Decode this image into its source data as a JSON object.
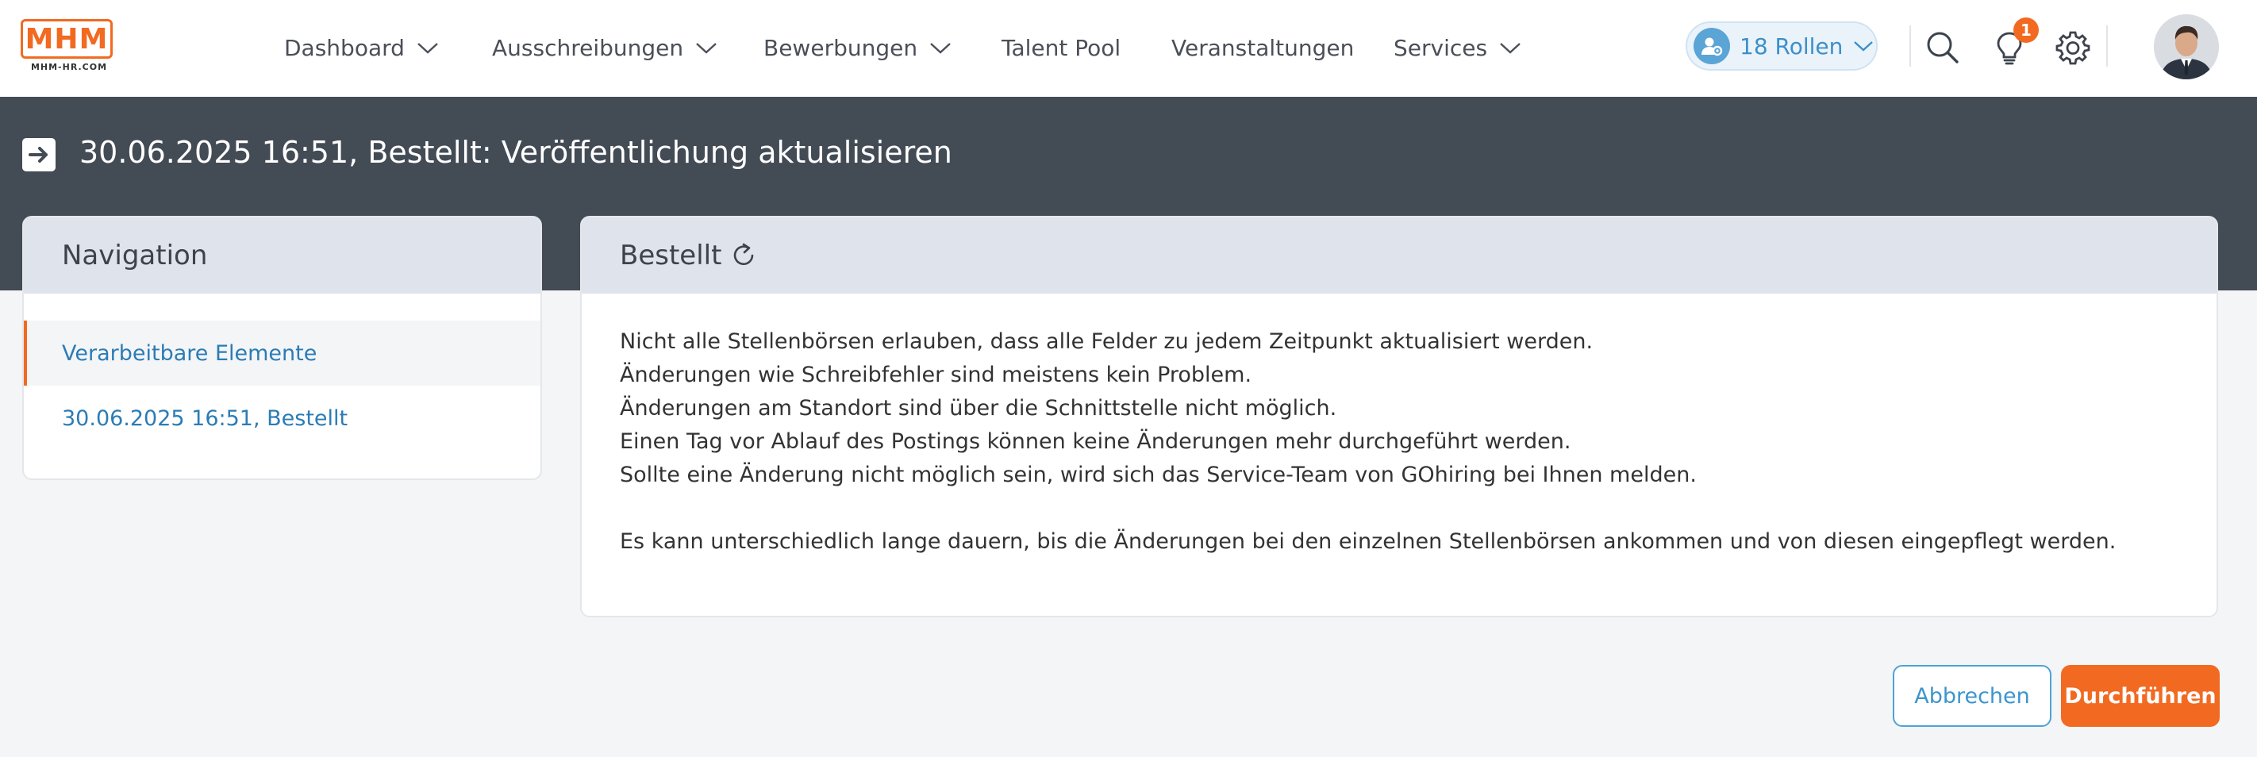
{
  "header": {
    "logo": {
      "text": "MHM",
      "subtext": "MHM-HR.COM"
    },
    "nav": [
      {
        "label": "Dashboard",
        "dropdown": true
      },
      {
        "label": "Ausschreibungen",
        "dropdown": true
      },
      {
        "label": "Bewerbungen",
        "dropdown": true
      },
      {
        "label": "Talent Pool",
        "dropdown": false
      },
      {
        "label": "Veranstaltungen",
        "dropdown": false
      },
      {
        "label": "Services",
        "dropdown": true
      }
    ],
    "roles_label": "18 Rollen",
    "notification_count": "1",
    "icons": [
      "user-gear-icon",
      "search-icon",
      "lightbulb-icon",
      "gear-icon",
      "avatar"
    ]
  },
  "page": {
    "title": "30.06.2025 16:51, Bestellt: Veröffentlichung aktualisieren"
  },
  "navigation": {
    "title": "Navigation",
    "items": [
      {
        "label": "Verarbeitbare Elemente",
        "active": true
      },
      {
        "label": "30.06.2025 16:51, Bestellt",
        "active": false
      }
    ]
  },
  "main": {
    "title": "Bestellt",
    "paragraph1": [
      "Nicht alle Stellenbörsen erlauben, dass alle Felder zu jedem Zeitpunkt aktualisiert werden.",
      "Änderungen wie Schreibfehler sind meistens kein Problem.",
      "Änderungen am Standort sind über die Schnittstelle nicht möglich.",
      "Einen Tag vor Ablauf des Postings können keine Änderungen mehr durchgeführt werden.",
      "Sollte eine Änderung nicht möglich sein, wird sich das Service-Team von GOhiring bei Ihnen melden."
    ],
    "paragraph2": "Es kann unterschiedlich lange dauern, bis die Änderungen bei den einzelnen Stellenbörsen ankommen und von diesen eingepflegt werden."
  },
  "actions": {
    "cancel_label": "Abbrechen",
    "run_label": "Durchführen"
  },
  "colors": {
    "accent": "#f26a21",
    "link": "#2b7cb5",
    "band": "#434b55",
    "card_head": "#dfe3eb"
  }
}
